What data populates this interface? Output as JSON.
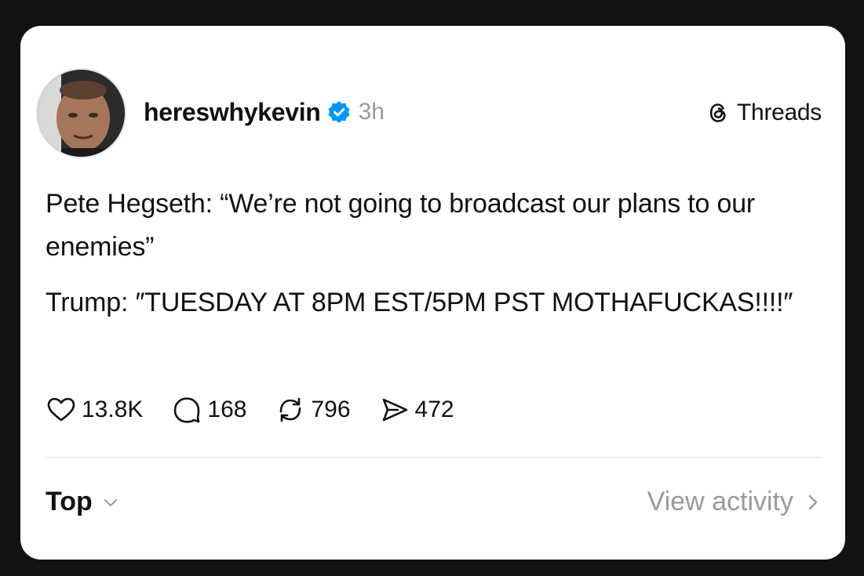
{
  "post": {
    "username": "hereswhykevin",
    "time": "3h",
    "brand_label": "Threads",
    "paragraphs": [
      "Pete Hegseth: “We’re not going to broadcast our plans to our enemies”",
      "Trump: ″TUESDAY AT 8PM EST/5PM PST MOTHAFUCKAS!!!!″"
    ],
    "stats": {
      "likes": "13.8K",
      "replies": "168",
      "reposts": "796",
      "shares": "472"
    }
  },
  "footer": {
    "sort_label": "Top",
    "view_activity_label": "View activity"
  },
  "colors": {
    "background": "#121212",
    "card": "#ffffff",
    "verified": "#0095f6",
    "muted": "#999999"
  },
  "icons": [
    "avatar",
    "verified-badge-icon",
    "threads-logo-icon",
    "heart-icon",
    "comment-icon",
    "repost-icon",
    "share-icon",
    "chevron-down-icon",
    "chevron-right-icon"
  ]
}
